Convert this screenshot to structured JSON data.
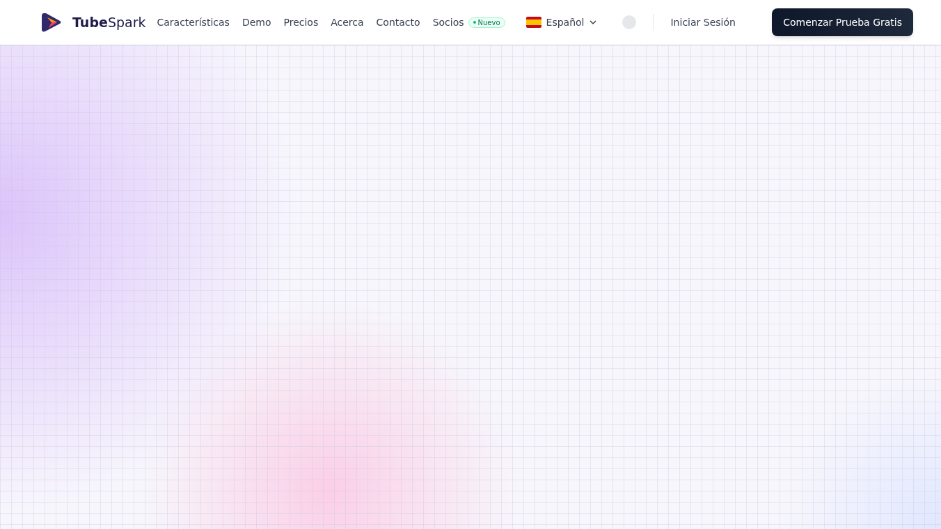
{
  "brand": {
    "name_bold": "Tube",
    "name_light": "Spark"
  },
  "nav": [
    {
      "label": "Características"
    },
    {
      "label": "Demo"
    },
    {
      "label": "Precios"
    },
    {
      "label": "Acerca"
    },
    {
      "label": "Contacto"
    },
    {
      "label": "Socios",
      "badge": "Nuevo"
    }
  ],
  "language": {
    "label": "Español"
  },
  "login": "Iniciar Sesión",
  "cta": "Comenzar Prueba Gratis"
}
